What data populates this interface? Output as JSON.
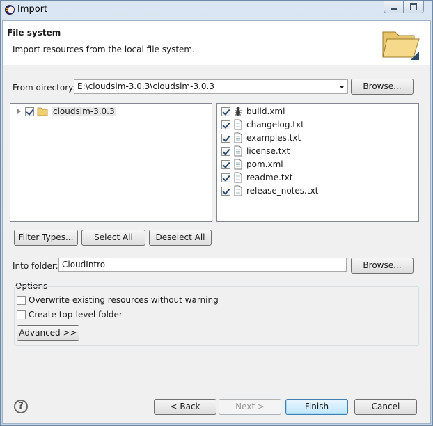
{
  "window": {
    "title": "Import"
  },
  "header": {
    "title": "File system",
    "description": "Import resources from the local file system."
  },
  "from_directory": {
    "label": "From directory:",
    "value": "E:\\cloudsim-3.0.3\\cloudsim-3.0.3",
    "browse_label": "Browse..."
  },
  "tree": {
    "items": [
      {
        "label": "cloudsim-3.0.3",
        "checked": true,
        "icon": "folder-icon"
      }
    ]
  },
  "files": {
    "items": [
      {
        "label": "build.xml",
        "checked": true,
        "icon": "ant-icon"
      },
      {
        "label": "changelog.txt",
        "checked": true,
        "icon": "text-file-icon"
      },
      {
        "label": "examples.txt",
        "checked": true,
        "icon": "text-file-icon"
      },
      {
        "label": "license.txt",
        "checked": true,
        "icon": "text-file-icon"
      },
      {
        "label": "pom.xml",
        "checked": true,
        "icon": "text-file-icon"
      },
      {
        "label": "readme.txt",
        "checked": true,
        "icon": "text-file-icon"
      },
      {
        "label": "release_notes.txt",
        "checked": true,
        "icon": "text-file-icon"
      }
    ]
  },
  "selection_buttons": {
    "filter_types": "Filter Types...",
    "select_all": "Select All",
    "deselect_all": "Deselect All"
  },
  "into_folder": {
    "label": "Into folder:",
    "value": "CloudIntro",
    "browse_label": "Browse..."
  },
  "options": {
    "title": "Options",
    "overwrite_label": "Overwrite existing resources without warning",
    "overwrite_checked": false,
    "top_level_label": "Create top-level folder",
    "top_level_checked": false,
    "advanced_label": "Advanced >>"
  },
  "footer": {
    "help_icon": "?",
    "back_label": "< Back",
    "next_label": "Next >",
    "finish_label": "Finish",
    "cancel_label": "Cancel"
  }
}
